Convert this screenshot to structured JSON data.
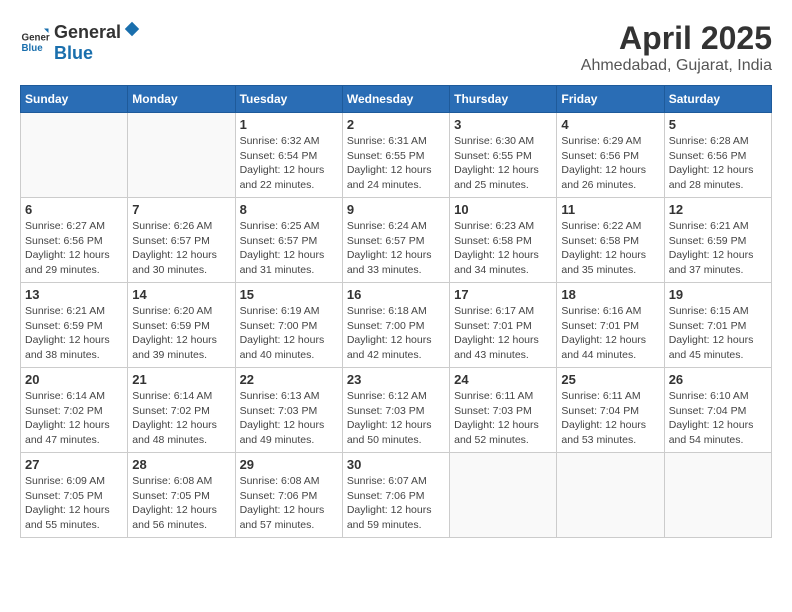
{
  "logo": {
    "general": "General",
    "blue": "Blue"
  },
  "header": {
    "month": "April 2025",
    "location": "Ahmedabad, Gujarat, India"
  },
  "weekdays": [
    "Sunday",
    "Monday",
    "Tuesday",
    "Wednesday",
    "Thursday",
    "Friday",
    "Saturday"
  ],
  "weeks": [
    [
      {
        "day": "",
        "info": ""
      },
      {
        "day": "",
        "info": ""
      },
      {
        "day": "1",
        "info": "Sunrise: 6:32 AM\nSunset: 6:54 PM\nDaylight: 12 hours and 22 minutes."
      },
      {
        "day": "2",
        "info": "Sunrise: 6:31 AM\nSunset: 6:55 PM\nDaylight: 12 hours and 24 minutes."
      },
      {
        "day": "3",
        "info": "Sunrise: 6:30 AM\nSunset: 6:55 PM\nDaylight: 12 hours and 25 minutes."
      },
      {
        "day": "4",
        "info": "Sunrise: 6:29 AM\nSunset: 6:56 PM\nDaylight: 12 hours and 26 minutes."
      },
      {
        "day": "5",
        "info": "Sunrise: 6:28 AM\nSunset: 6:56 PM\nDaylight: 12 hours and 28 minutes."
      }
    ],
    [
      {
        "day": "6",
        "info": "Sunrise: 6:27 AM\nSunset: 6:56 PM\nDaylight: 12 hours and 29 minutes."
      },
      {
        "day": "7",
        "info": "Sunrise: 6:26 AM\nSunset: 6:57 PM\nDaylight: 12 hours and 30 minutes."
      },
      {
        "day": "8",
        "info": "Sunrise: 6:25 AM\nSunset: 6:57 PM\nDaylight: 12 hours and 31 minutes."
      },
      {
        "day": "9",
        "info": "Sunrise: 6:24 AM\nSunset: 6:57 PM\nDaylight: 12 hours and 33 minutes."
      },
      {
        "day": "10",
        "info": "Sunrise: 6:23 AM\nSunset: 6:58 PM\nDaylight: 12 hours and 34 minutes."
      },
      {
        "day": "11",
        "info": "Sunrise: 6:22 AM\nSunset: 6:58 PM\nDaylight: 12 hours and 35 minutes."
      },
      {
        "day": "12",
        "info": "Sunrise: 6:21 AM\nSunset: 6:59 PM\nDaylight: 12 hours and 37 minutes."
      }
    ],
    [
      {
        "day": "13",
        "info": "Sunrise: 6:21 AM\nSunset: 6:59 PM\nDaylight: 12 hours and 38 minutes."
      },
      {
        "day": "14",
        "info": "Sunrise: 6:20 AM\nSunset: 6:59 PM\nDaylight: 12 hours and 39 minutes."
      },
      {
        "day": "15",
        "info": "Sunrise: 6:19 AM\nSunset: 7:00 PM\nDaylight: 12 hours and 40 minutes."
      },
      {
        "day": "16",
        "info": "Sunrise: 6:18 AM\nSunset: 7:00 PM\nDaylight: 12 hours and 42 minutes."
      },
      {
        "day": "17",
        "info": "Sunrise: 6:17 AM\nSunset: 7:01 PM\nDaylight: 12 hours and 43 minutes."
      },
      {
        "day": "18",
        "info": "Sunrise: 6:16 AM\nSunset: 7:01 PM\nDaylight: 12 hours and 44 minutes."
      },
      {
        "day": "19",
        "info": "Sunrise: 6:15 AM\nSunset: 7:01 PM\nDaylight: 12 hours and 45 minutes."
      }
    ],
    [
      {
        "day": "20",
        "info": "Sunrise: 6:14 AM\nSunset: 7:02 PM\nDaylight: 12 hours and 47 minutes."
      },
      {
        "day": "21",
        "info": "Sunrise: 6:14 AM\nSunset: 7:02 PM\nDaylight: 12 hours and 48 minutes."
      },
      {
        "day": "22",
        "info": "Sunrise: 6:13 AM\nSunset: 7:03 PM\nDaylight: 12 hours and 49 minutes."
      },
      {
        "day": "23",
        "info": "Sunrise: 6:12 AM\nSunset: 7:03 PM\nDaylight: 12 hours and 50 minutes."
      },
      {
        "day": "24",
        "info": "Sunrise: 6:11 AM\nSunset: 7:03 PM\nDaylight: 12 hours and 52 minutes."
      },
      {
        "day": "25",
        "info": "Sunrise: 6:11 AM\nSunset: 7:04 PM\nDaylight: 12 hours and 53 minutes."
      },
      {
        "day": "26",
        "info": "Sunrise: 6:10 AM\nSunset: 7:04 PM\nDaylight: 12 hours and 54 minutes."
      }
    ],
    [
      {
        "day": "27",
        "info": "Sunrise: 6:09 AM\nSunset: 7:05 PM\nDaylight: 12 hours and 55 minutes."
      },
      {
        "day": "28",
        "info": "Sunrise: 6:08 AM\nSunset: 7:05 PM\nDaylight: 12 hours and 56 minutes."
      },
      {
        "day": "29",
        "info": "Sunrise: 6:08 AM\nSunset: 7:06 PM\nDaylight: 12 hours and 57 minutes."
      },
      {
        "day": "30",
        "info": "Sunrise: 6:07 AM\nSunset: 7:06 PM\nDaylight: 12 hours and 59 minutes."
      },
      {
        "day": "",
        "info": ""
      },
      {
        "day": "",
        "info": ""
      },
      {
        "day": "",
        "info": ""
      }
    ]
  ]
}
